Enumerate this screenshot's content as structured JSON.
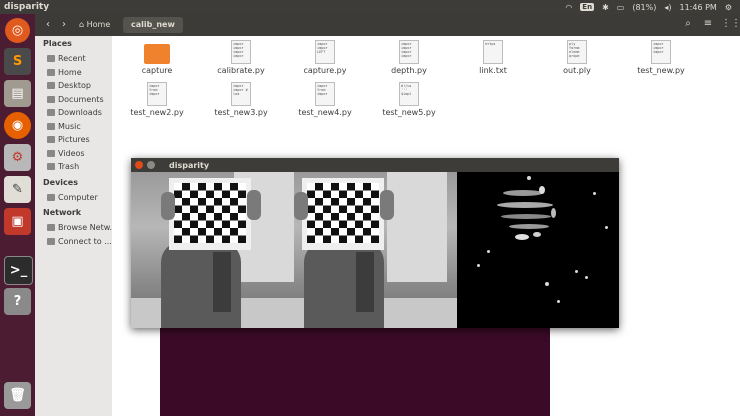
{
  "topbar": {
    "title": "disparity",
    "keyboard": "En",
    "battery": "(81%)",
    "clock": "11:46 PM"
  },
  "launcher": {
    "icons": [
      "ubuntu-icon",
      "sublime-icon",
      "files-icon",
      "firefox-icon",
      "settings-icon",
      "text-editor-icon",
      "system-monitor-icon",
      "terminal-icon",
      "help-icon",
      "trash-icon"
    ]
  },
  "toolbar": {
    "back": "‹",
    "forward": "›",
    "home_label": "Home",
    "current": "calib_new",
    "search_icon": "⌕",
    "menu_icon": "≡",
    "grid_icon": "⋮⋮"
  },
  "sidebar": {
    "places_header": "Places",
    "places": [
      "Recent",
      "Home",
      "Desktop",
      "Documents",
      "Downloads",
      "Music",
      "Pictures",
      "Videos",
      "Trash"
    ],
    "devices_header": "Devices",
    "devices": [
      "Computer"
    ],
    "network_header": "Network",
    "network": [
      "Browse Netw...",
      "Connect to ..."
    ]
  },
  "files": [
    {
      "name": "capture",
      "kind": "folder",
      "preview": ""
    },
    {
      "name": "calibrate.py",
      "kind": "doc",
      "preview": "impor impor impor impor"
    },
    {
      "name": "capture.py",
      "kind": "doc",
      "preview": "impor impor LEFT"
    },
    {
      "name": "depth.py",
      "kind": "doc",
      "preview": "impor impor impor impor"
    },
    {
      "name": "link.txt",
      "kind": "doc",
      "preview": "https"
    },
    {
      "name": "out.ply",
      "kind": "doc",
      "preview": "ply forma eleme prope"
    },
    {
      "name": "test_new.py",
      "kind": "doc",
      "preview": "impor impor impor"
    },
    {
      "name": "test_new2.py",
      "kind": "doc",
      "preview": "impor from impor"
    },
    {
      "name": "test_new3.py",
      "kind": "doc",
      "preview": "impor impor # loa"
    },
    {
      "name": "test_new4.py",
      "kind": "doc",
      "preview": "impor from impor"
    },
    {
      "name": "test_new5.py",
      "kind": "doc",
      "preview": "#!/us ''' $impl"
    }
  ],
  "disparity_window": {
    "title": "disparity"
  },
  "colors": {
    "launcher": "#4c1c33",
    "topbar": "#3d3c38",
    "folder": "#f0822e",
    "close": "#df4a16"
  }
}
